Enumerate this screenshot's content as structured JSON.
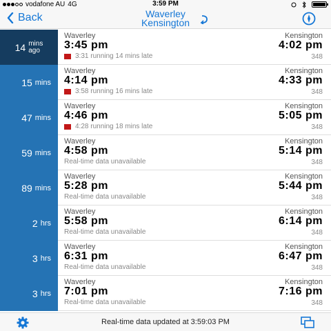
{
  "status_bar": {
    "carrier": "vodafone AU",
    "network": "4G",
    "time": "3:59 PM"
  },
  "nav": {
    "back_label": "Back",
    "title_line1": "Waverley",
    "title_line2": "Kensington"
  },
  "trips": [
    {
      "countdown_value": "14",
      "countdown_unit_1": "mins",
      "countdown_unit_2": "ago",
      "origin": "Waverley",
      "destination": "Kensington",
      "departure": "3:45 pm",
      "arrival": "4:02 pm",
      "note": "3:31 running 14 mins late",
      "route": "348"
    },
    {
      "countdown_value": "15",
      "countdown_unit": "mins",
      "origin": "Waverley",
      "destination": "Kensington",
      "departure": "4:14 pm",
      "arrival": "4:33 pm",
      "note": "3:58 running 16 mins late",
      "route": "348"
    },
    {
      "countdown_value": "47",
      "countdown_unit": "mins",
      "origin": "Waverley",
      "destination": "Kensington",
      "departure": "4:46 pm",
      "arrival": "5:05 pm",
      "note": "4:28 running 18 mins late",
      "route": "348"
    },
    {
      "countdown_value": "59",
      "countdown_unit": "mins",
      "origin": "Waverley",
      "destination": "Kensington",
      "departure": "4:58 pm",
      "arrival": "5:14 pm",
      "note": "Real-time data unavailable",
      "route": "348"
    },
    {
      "countdown_value": "89",
      "countdown_unit": "mins",
      "origin": "Waverley",
      "destination": "Kensington",
      "departure": "5:28 pm",
      "arrival": "5:44 pm",
      "note": "Real-time data unavailable",
      "route": "348"
    },
    {
      "countdown_value": "2",
      "countdown_unit": "hrs",
      "origin": "Waverley",
      "destination": "Kensington",
      "departure": "5:58 pm",
      "arrival": "6:14 pm",
      "note": "Real-time data unavailable",
      "route": "348"
    },
    {
      "countdown_value": "3",
      "countdown_unit": "hrs",
      "origin": "Waverley",
      "destination": "Kensington",
      "departure": "6:31 pm",
      "arrival": "6:47 pm",
      "note": "Real-time data unavailable",
      "route": "348"
    },
    {
      "countdown_value": "3",
      "countdown_unit": "hrs",
      "origin": "Waverley",
      "destination": "Kensington",
      "departure": "7:01 pm",
      "arrival": "7:16 pm",
      "note": "Real-time data unavailable",
      "route": "348"
    }
  ],
  "toolbar": {
    "update_text": "Real-time data updated at 3:59:03 PM"
  },
  "colors": {
    "accent": "#1577d6",
    "tile": "#2573b4",
    "tile_past": "#153c5f",
    "late": "#c21818"
  },
  "icons": {
    "back": "chevron-left-icon",
    "swap": "swap-direction-icon",
    "compass": "compass-icon",
    "settings": "gear-icon",
    "windows": "windows-icon"
  }
}
